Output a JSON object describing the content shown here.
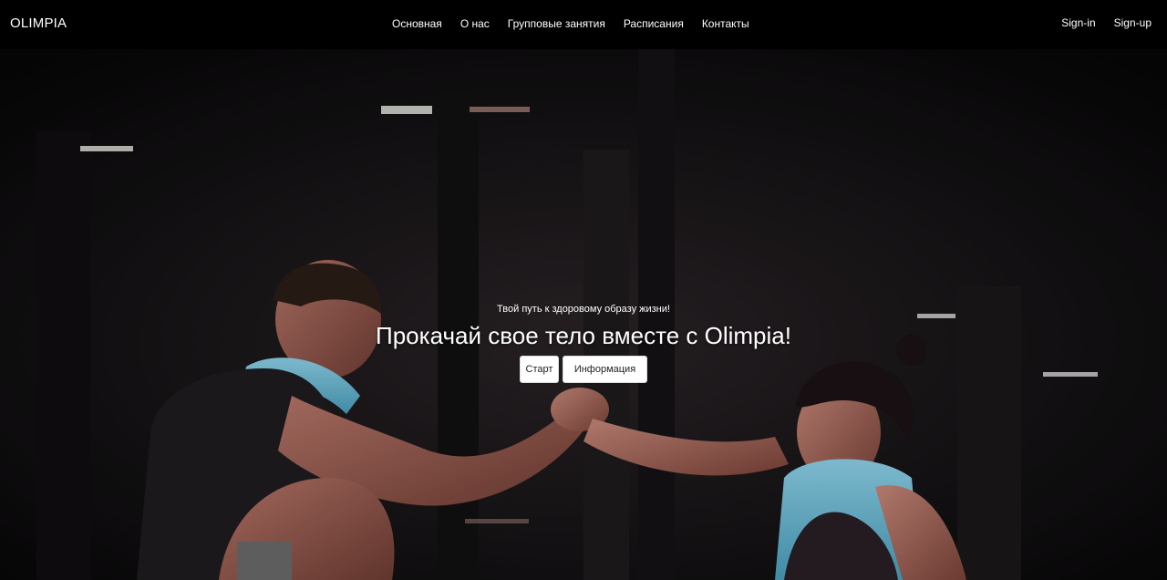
{
  "navbar": {
    "brand": "OLIMPIA",
    "links": [
      {
        "label": "Основная"
      },
      {
        "label": "О нас"
      },
      {
        "label": "Групповые занятия"
      },
      {
        "label": "Расписания"
      },
      {
        "label": "Контакты"
      }
    ],
    "auth": {
      "signin": "Sign-in",
      "signup": "Sign-up"
    }
  },
  "hero": {
    "subtitle": "Твой путь к здоровому образу жизни!",
    "title": "Прокачай свое тело вместе с Olimpia!",
    "buttons": {
      "start": "Старт",
      "info": "Информация"
    },
    "background_image": "gym photo: man and woman clasping hands in a dark gym"
  },
  "colors": {
    "navbar_bg": "#000000",
    "text": "#ffffff",
    "button_bg": "#ffffff",
    "towel": "#7ec8e3"
  }
}
